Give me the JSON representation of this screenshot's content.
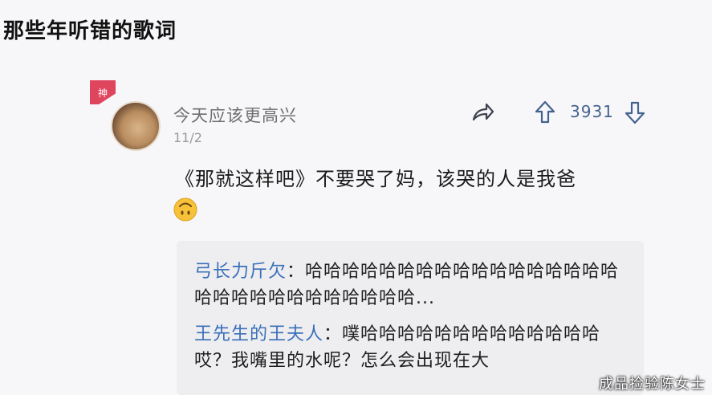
{
  "page": {
    "title": "那些年听错的歌词"
  },
  "post": {
    "badge_label": "神",
    "username": "今天应该更高兴",
    "date": "11/2",
    "vote_count": "3931",
    "comment": "《那就这样吧》不要哭了妈，该哭的人是我爸",
    "emoji": "upside-down-face-emoji"
  },
  "replies": [
    {
      "author": "弓长力斤欠",
      "separator": "：",
      "text": "哈哈哈哈哈哈哈哈哈哈哈哈哈哈哈哈哈哈哈哈哈哈哈哈哈哈哈哈哈..."
    },
    {
      "author": "王先生的王夫人",
      "separator": "：",
      "text": "噗哈哈哈哈哈哈哈哈哈哈哈哈哈 哎？我嘴里的水呢？怎么会出现在大"
    }
  ],
  "watermark": "成品捡验陈女士",
  "colors": {
    "accent": "#45628f",
    "reply_author": "#3a6fb8",
    "badge": "#e0455e"
  },
  "icons": [
    "share-icon",
    "upvote-arrow-icon",
    "downvote-arrow-icon"
  ]
}
